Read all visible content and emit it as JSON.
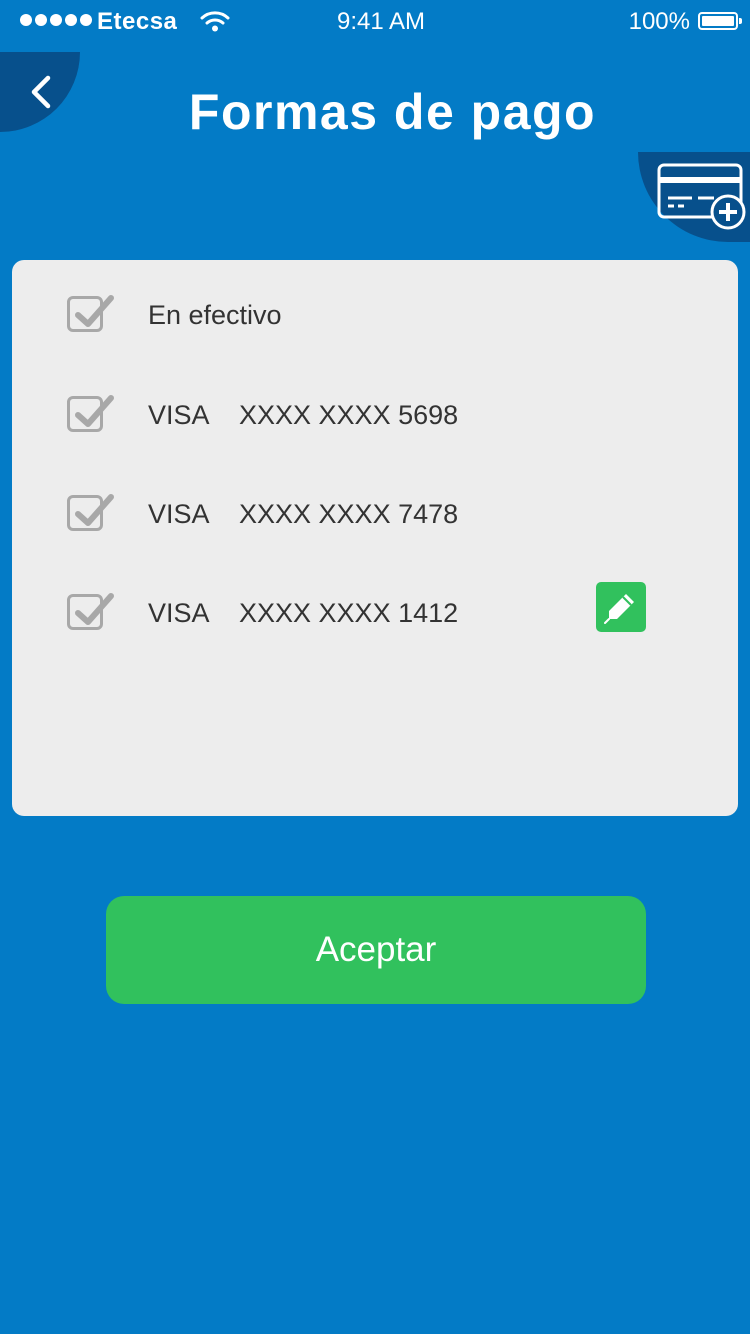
{
  "status_bar": {
    "carrier": "Etecsa",
    "time": "9:41 AM",
    "battery": "100%"
  },
  "header": {
    "title": "Formas de pago",
    "back_icon": "chevron-left-icon",
    "add_icon": "credit-card-add-icon"
  },
  "payment_methods": [
    {
      "label": "En efectivo",
      "checked": true
    },
    {
      "brand": "VISA",
      "number": "XXXX XXXX 5698",
      "checked": true
    },
    {
      "brand": "VISA",
      "number": "XXXX XXXX 7478",
      "checked": true
    },
    {
      "brand": "VISA",
      "number": "XXXX XXXX 1412",
      "checked": true
    }
  ],
  "edit_icon": "pencil-icon",
  "accept_label": "Aceptar",
  "colors": {
    "background": "#037BC6",
    "header_button": "#07508C",
    "panel": "#EDEDED",
    "accent_green": "#31C15D"
  }
}
